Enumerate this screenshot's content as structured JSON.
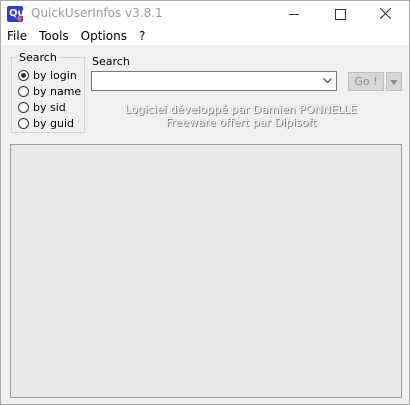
{
  "window": {
    "title": "QuickUserInfos v3.8.1",
    "icon_letters": "Qu"
  },
  "menu": {
    "items": [
      "File",
      "Tools",
      "Options",
      "?"
    ]
  },
  "search_group": {
    "title": "Search",
    "options": [
      {
        "label": "by login",
        "checked": true
      },
      {
        "label": "by name",
        "checked": false
      },
      {
        "label": "by sid",
        "checked": false
      },
      {
        "label": "by guid",
        "checked": false
      }
    ]
  },
  "search": {
    "label": "Search",
    "value": ""
  },
  "go_button": {
    "label": "Go !"
  },
  "credits": {
    "line1": "Logiciel développé par Damien PONNELLE",
    "line2": "Freeware offert par Dipisoft"
  },
  "colors": {
    "titlebar_bg": "#ffffff",
    "window_bg": "#f0f0f0",
    "icon_blue": "#2b3fd6",
    "results_bg": "#e9e9e9"
  }
}
